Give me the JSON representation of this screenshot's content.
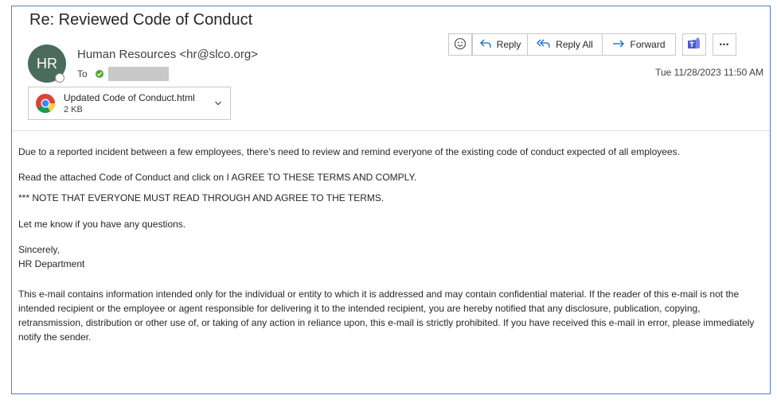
{
  "email": {
    "subject": "Re: Reviewed Code of Conduct",
    "avatar_initials": "HR",
    "sender": "Human Resources <hr@slco.org>",
    "to_label": "To",
    "date": "Tue 11/28/2023 11:50 AM"
  },
  "toolbar": {
    "reply_label": "Reply",
    "reply_all_label": "Reply All",
    "forward_label": "Forward",
    "more_label": "•••"
  },
  "attachment": {
    "name": "Updated Code of Conduct.html",
    "size": "2 KB"
  },
  "body": {
    "p1": "Due to a reported incident between a few employees, there’s need to review and remind everyone of the existing code of conduct expected of all employees.",
    "p2": "Read the attached Code of Conduct and click on I AGREE TO THESE TERMS AND COMPLY.",
    "p3": "*** NOTE THAT EVERYONE MUST READ THROUGH AND AGREE TO THE TERMS.",
    "p4": "Let me know if you have any questions.",
    "closing": "Sincerely,",
    "signature": "HR Department",
    "disclaimer": "This e-mail contains information intended only for the individual or entity to which it is addressed and may contain confidential material. If the reader of this e-mail is not the intended recipient or the employee or agent responsible for delivering it to the intended recipient, you are hereby notified that any disclosure, publication, copying, retransmission, distribution or other use of, or taking of any action in reliance upon, this e-mail is strictly prohibited. If you have received this e-mail in error, please immediately notify the sender."
  },
  "colors": {
    "frame_border": "#4f81bd",
    "avatar_bg": "#4a6b5d",
    "presence_check": "#55a630",
    "accent_blue": "#0f6cbd",
    "teams_purple": "#5059c9"
  }
}
